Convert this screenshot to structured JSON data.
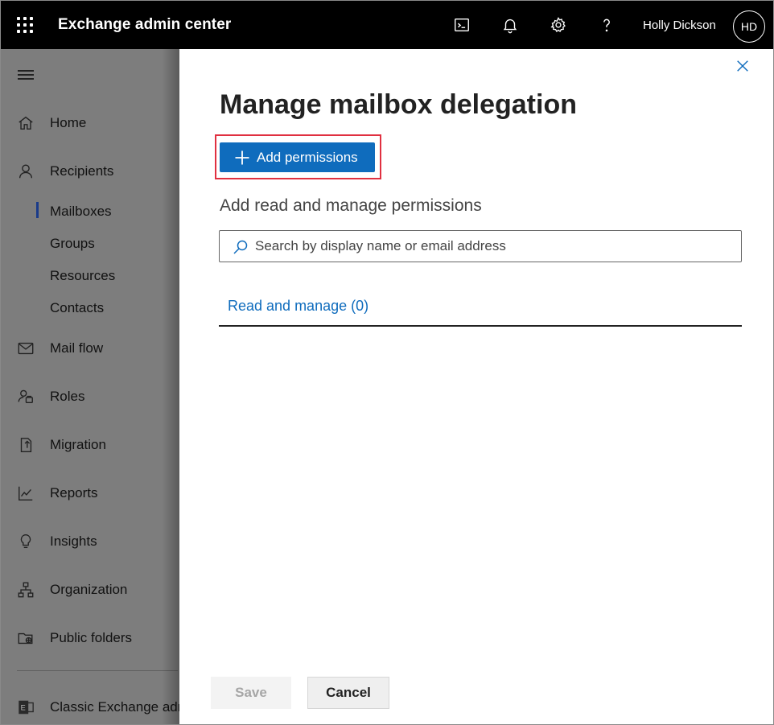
{
  "topbar": {
    "app_title": "Exchange admin center",
    "icons": [
      "waffle-icon",
      "terminal-icon",
      "bell-icon",
      "gear-icon",
      "help-icon"
    ],
    "user_name": "Holly Dickson",
    "user_initials": "HD",
    "background": "#000000"
  },
  "sidebar": {
    "items": [
      {
        "label": "Home",
        "icon": "home-icon"
      },
      {
        "label": "Recipients",
        "icon": "person-icon"
      },
      {
        "label": "Mail flow",
        "icon": "mail-icon"
      },
      {
        "label": "Roles",
        "icon": "roles-icon"
      },
      {
        "label": "Migration",
        "icon": "migration-icon"
      },
      {
        "label": "Reports",
        "icon": "chart-icon"
      },
      {
        "label": "Insights",
        "icon": "lightbulb-icon"
      },
      {
        "label": "Organization",
        "icon": "org-chart-icon"
      },
      {
        "label": "Public folders",
        "icon": "folder-icon"
      },
      {
        "label": "Classic Exchange admi",
        "icon": "exchange-icon"
      }
    ],
    "recipients_sub": [
      "Mailboxes",
      "Groups",
      "Resources",
      "Contacts"
    ],
    "selected_sub": "Mailboxes"
  },
  "panel": {
    "title": "Manage mailbox delegation",
    "add_button_label": "Add permissions",
    "section_title": "Add read and manage permissions",
    "search_placeholder": "Search by display name or email address",
    "tab_label": "Read and manage (0)",
    "save_label": "Save",
    "cancel_label": "Cancel",
    "accent_color": "#0f6cbd",
    "highlight_color": "#e03040"
  }
}
